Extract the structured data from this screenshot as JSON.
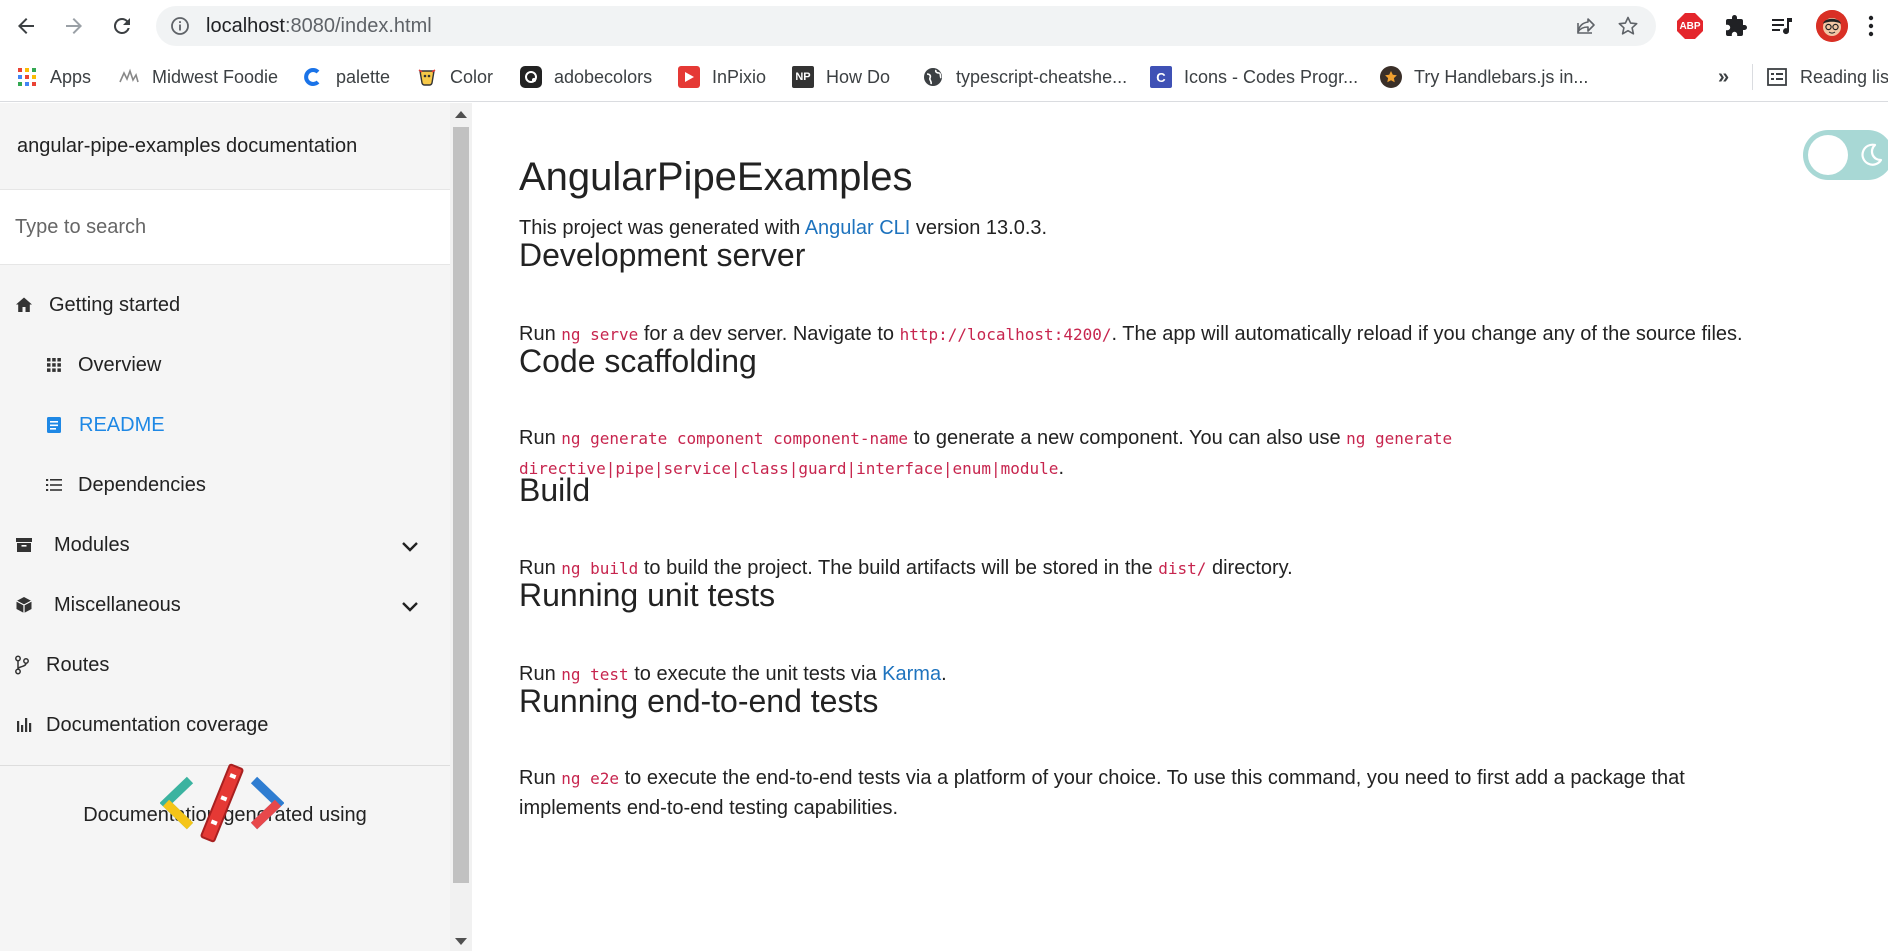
{
  "browser": {
    "url_host": "localhost",
    "url_rest": ":8080/index.html",
    "bookmarks": [
      {
        "label": "Apps",
        "icon": "apps-grid-icon"
      },
      {
        "label": "Midwest Foodie",
        "icon": "midwest-foodie-icon"
      },
      {
        "label": "palette",
        "icon": "palette-icon"
      },
      {
        "label": "Color",
        "icon": "color-icon"
      },
      {
        "label": "adobecolors",
        "icon": "adobecolors-icon"
      },
      {
        "label": "InPixio",
        "icon": "inpixio-icon"
      },
      {
        "label": "How Do",
        "icon": "np-icon"
      },
      {
        "label": "typescript-cheatshe...",
        "icon": "globe-icon"
      },
      {
        "label": "Icons - Codes Progr...",
        "icon": "codes-icon"
      },
      {
        "label": "Try Handlebars.js in...",
        "icon": "handlebars-icon"
      }
    ],
    "overflow_label": "»",
    "reading_list_label": "Reading lis",
    "extensions": [
      "abp-icon",
      "puzzle-icon",
      "media-icon",
      "avatar"
    ],
    "abp_label": "ABP"
  },
  "sidebar": {
    "title": "angular-pipe-examples documentation",
    "search_placeholder": "Type to search",
    "items": [
      {
        "label": "Getting started",
        "icon": "home-icon"
      },
      {
        "label": "Overview",
        "icon": "grid-icon"
      },
      {
        "label": "README",
        "icon": "readme-icon"
      },
      {
        "label": "Dependencies",
        "icon": "list-icon"
      },
      {
        "label": "Modules",
        "icon": "archive-icon"
      },
      {
        "label": "Miscellaneous",
        "icon": "cube-icon"
      },
      {
        "label": "Routes",
        "icon": "routes-icon"
      },
      {
        "label": "Documentation coverage",
        "icon": "bar-chart-icon"
      }
    ],
    "footer": "Documentation generated using"
  },
  "content": {
    "title": "AngularPipeExamples",
    "intro": {
      "before": "This project was generated with ",
      "link": "Angular CLI",
      "after": " version 13.0.3."
    },
    "dev_server": {
      "heading": "Development server",
      "run": "Run ",
      "code1": "ng serve",
      "mid": " for a dev server. Navigate to ",
      "code2": "http://localhost:4200/",
      "after": ". The app will automatically reload if you change any of the source files."
    },
    "scaffolding": {
      "heading": "Code scaffolding",
      "run": "Run ",
      "code1": "ng generate component component-name",
      "mid": " to generate a new component. You can also use ",
      "code2": "ng generate",
      "code3": "directive|pipe|service|class|guard|interface|enum|module",
      "after": "."
    },
    "build": {
      "heading": "Build",
      "run": "Run ",
      "code1": "ng build",
      "mid": " to build the project. The build artifacts will be stored in the ",
      "code2": "dist/",
      "after": " directory."
    },
    "unit_tests": {
      "heading": "Running unit tests",
      "run": "Run ",
      "code1": "ng test",
      "mid": " to execute the unit tests via ",
      "link": "Karma",
      "after": "."
    },
    "e2e": {
      "heading": "Running end-to-end tests",
      "run": "Run ",
      "code1": "ng e2e",
      "line1": " to execute the end-to-end tests via a platform of your choice. To use this command, you need to first add a package that",
      "line2": "implements end-to-end testing capabilities."
    }
  },
  "colors": {
    "accent": "#1e88e5",
    "link": "#1e73be",
    "code": "#c7254e",
    "toggle": "#a8d8d5"
  }
}
